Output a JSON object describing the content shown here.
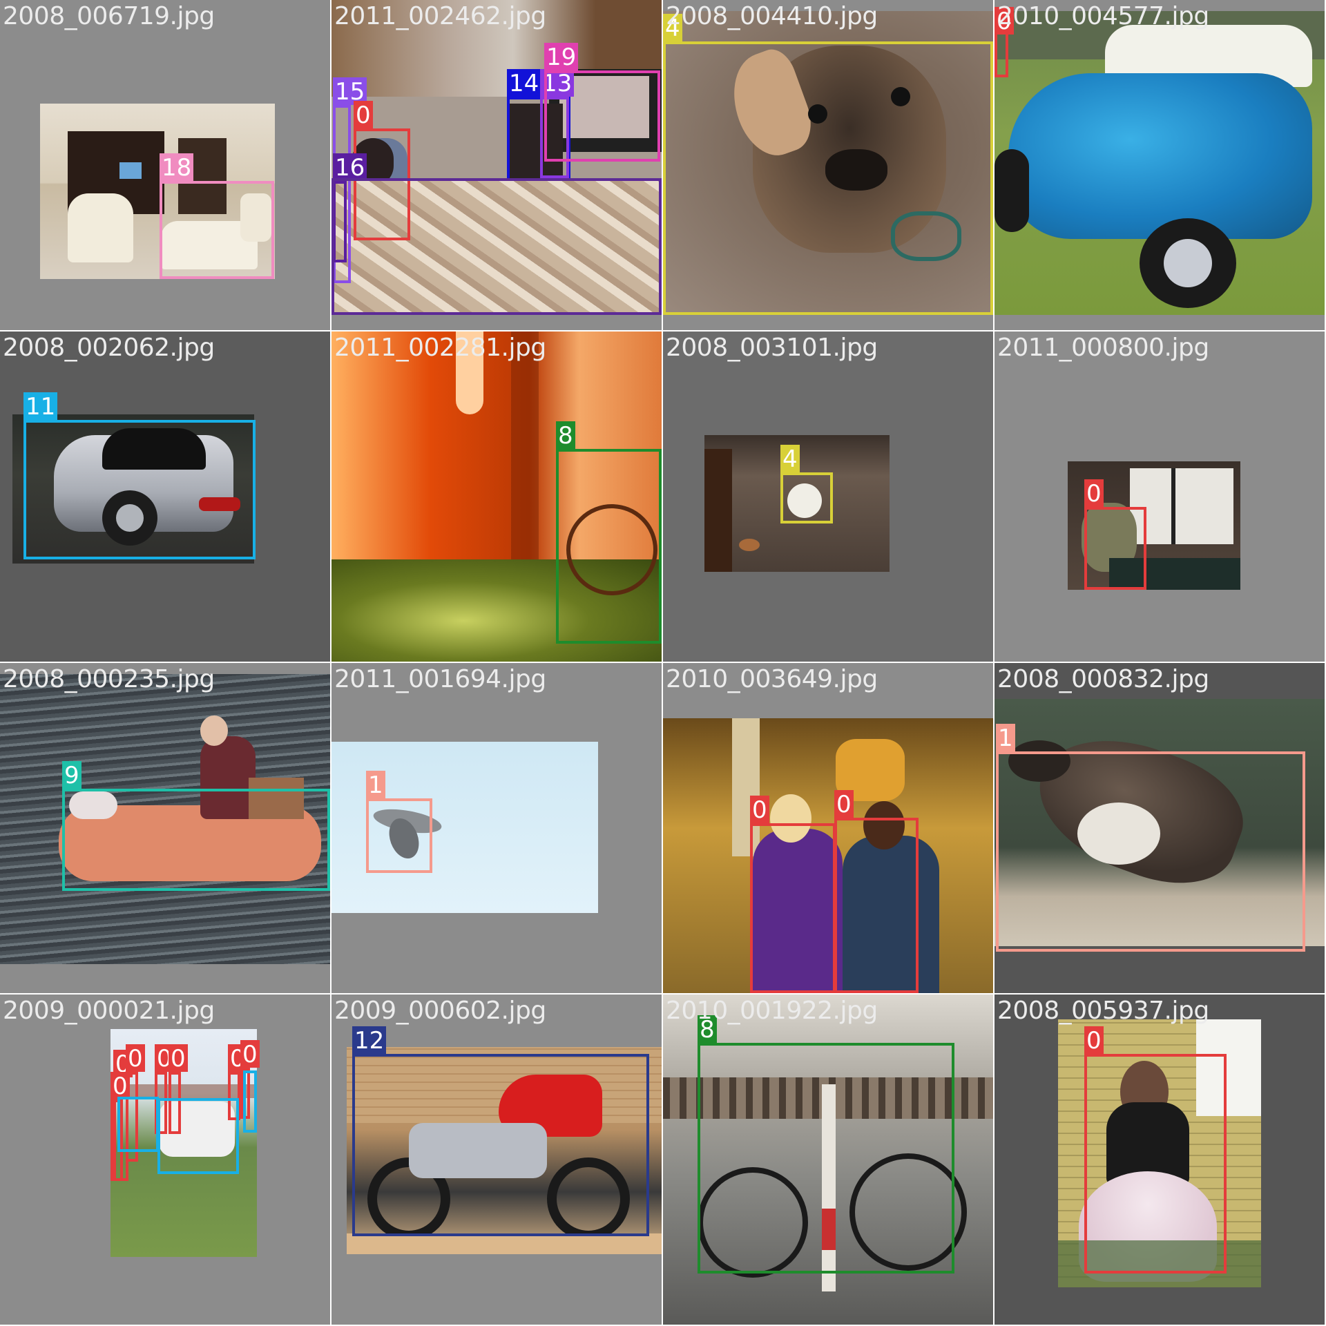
{
  "tiles": [
    {
      "filename": "2008_006719.jpg",
      "boxes": [
        {
          "label": "18",
          "color": "#f08cc0"
        }
      ]
    },
    {
      "filename": "2011_002462.jpg",
      "boxes": [
        {
          "label": "15",
          "color": "#8a4ee8"
        },
        {
          "label": "0",
          "color": "#e43c3c"
        },
        {
          "label": "16",
          "color": "#5a1ea0"
        },
        {
          "label": "14",
          "color": "#1212d8"
        },
        {
          "label": "13",
          "color": "#8a38e0"
        },
        {
          "label": "19",
          "color": "#e040b0"
        },
        {
          "label": "",
          "color": "#5c2a96"
        }
      ]
    },
    {
      "filename": "2008_004410.jpg",
      "boxes": [
        {
          "label": "4",
          "color": "#d8d038"
        }
      ]
    },
    {
      "filename": "2010_004577.jpg",
      "boxes": [
        {
          "label": "0",
          "color": "#e43c3c"
        }
      ]
    },
    {
      "filename": "2008_002062.jpg",
      "boxes": [
        {
          "label": "11",
          "color": "#18b0e6"
        }
      ]
    },
    {
      "filename": "2011_002281.jpg",
      "boxes": [
        {
          "label": "8",
          "color": "#1e8c2c"
        }
      ]
    },
    {
      "filename": "2008_003101.jpg",
      "boxes": [
        {
          "label": "4",
          "color": "#d8d038"
        }
      ]
    },
    {
      "filename": "2011_000800.jpg",
      "boxes": [
        {
          "label": "0",
          "color": "#e43c3c"
        }
      ]
    },
    {
      "filename": "2008_000235.jpg",
      "boxes": [
        {
          "label": "9",
          "color": "#1ec0a8"
        }
      ]
    },
    {
      "filename": "2011_001694.jpg",
      "boxes": [
        {
          "label": "1",
          "color": "#f59a8c"
        }
      ]
    },
    {
      "filename": "2010_003649.jpg",
      "boxes": [
        {
          "label": "0",
          "color": "#e43c3c"
        },
        {
          "label": "0",
          "color": "#e43c3c"
        }
      ]
    },
    {
      "filename": "2008_000832.jpg",
      "boxes": [
        {
          "label": "1",
          "color": "#f59a8c"
        }
      ]
    },
    {
      "filename": "2009_000021.jpg",
      "boxes": [
        {
          "label": "0",
          "color": "#e43c3c"
        },
        {
          "label": "0",
          "color": "#e43c3c"
        },
        {
          "label": "0",
          "color": "#e43c3c"
        },
        {
          "label": "0",
          "color": "#e43c3c"
        },
        {
          "label": "0",
          "color": "#e43c3c"
        },
        {
          "label": "0",
          "color": "#e43c3c"
        },
        {
          "label": "0",
          "color": "#e43c3c"
        },
        {
          "label": "",
          "color": "#18b0e6"
        },
        {
          "label": "",
          "color": "#18b0e6"
        },
        {
          "label": "",
          "color": "#18b0e6"
        }
      ]
    },
    {
      "filename": "2009_000602.jpg",
      "boxes": [
        {
          "label": "12",
          "color": "#2a3a8c"
        }
      ]
    },
    {
      "filename": "2010_001922.jpg",
      "boxes": [
        {
          "label": "8",
          "color": "#1e8c2c"
        }
      ]
    },
    {
      "filename": "2008_005937.jpg",
      "boxes": [
        {
          "label": "0",
          "color": "#e43c3c"
        }
      ]
    }
  ]
}
